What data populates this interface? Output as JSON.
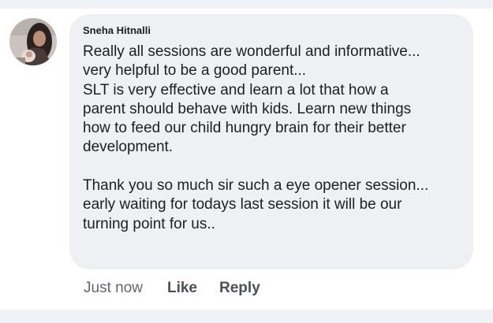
{
  "comment": {
    "author": "Sneha Hitnalli",
    "paragraph1": [
      "Really all sessions are wonderful and informative...",
      "very helpful to be a good parent...",
      "SLT is very effective and learn a lot that how a",
      "parent should behave with kids. Learn new things",
      "how to feed our child hungry brain for their better",
      "development."
    ],
    "paragraph2": [
      "Thank you so much sir such a eye opener session...",
      "early waiting for todays last session it will be our",
      "turning point for us.."
    ]
  },
  "actions": {
    "timestamp": "Just now",
    "like_label": "Like",
    "reply_label": "Reply"
  },
  "colors": {
    "page_background": "#f0f2f5",
    "bubble_background": "#eef0f3",
    "text": "#1c1e21",
    "muted_text": "#65676b"
  },
  "icons": {
    "avatar": "profile-photo"
  }
}
